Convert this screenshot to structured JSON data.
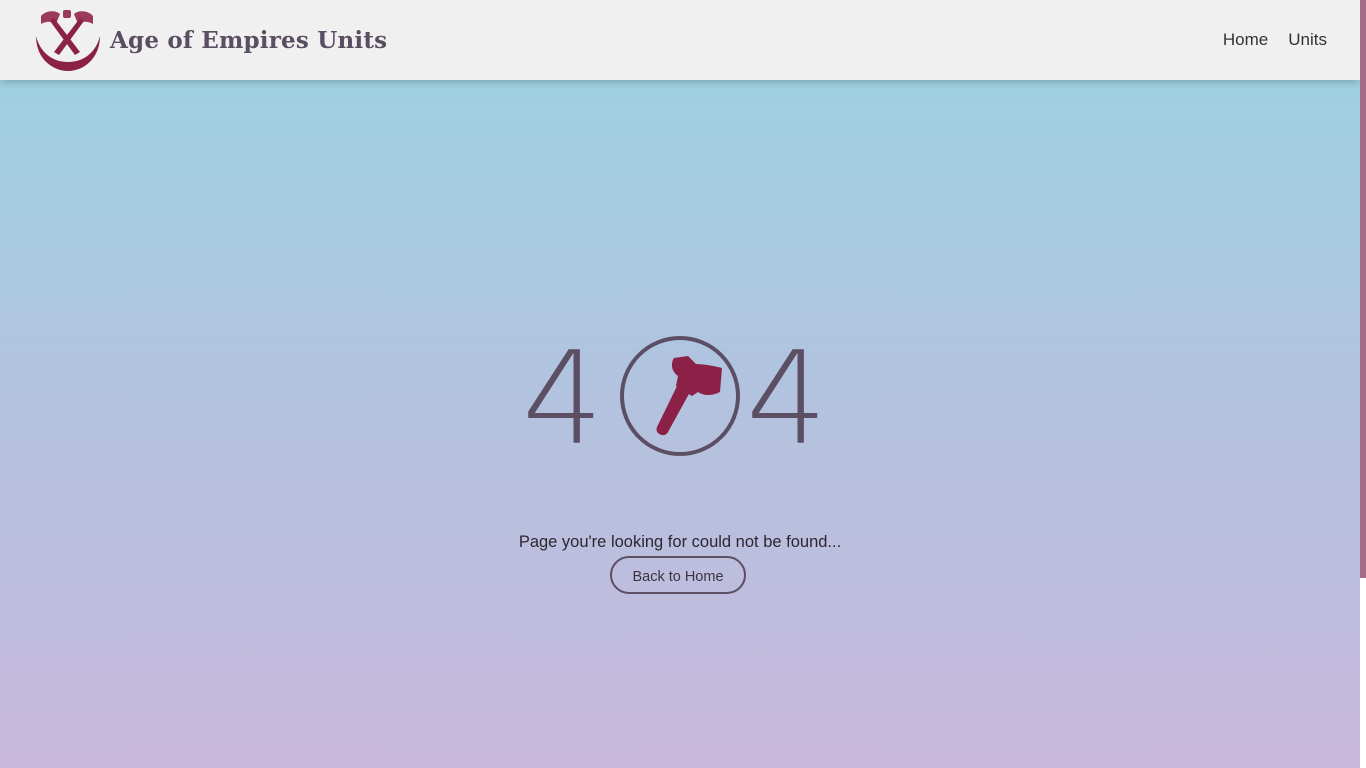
{
  "header": {
    "brand_title": "Age of Empires Units",
    "logo_icon": "crossed-axes-logo-icon",
    "nav": [
      {
        "label": "Home"
      },
      {
        "label": "Units"
      }
    ]
  },
  "error": {
    "code_left": "4",
    "code_right": "4",
    "code_middle_icon": "axe-in-circle-icon",
    "message": "Page you're looking for could not be found...",
    "back_button_label": "Back to Home"
  },
  "colors": {
    "accent": "#8b2146",
    "text_dark": "#5c4e63",
    "navbar_bg": "#f0f0f0",
    "gradient_top": "#9ad5e1",
    "gradient_bottom": "#c8b8dc",
    "scrollbar_thumb": "#a66b86"
  }
}
